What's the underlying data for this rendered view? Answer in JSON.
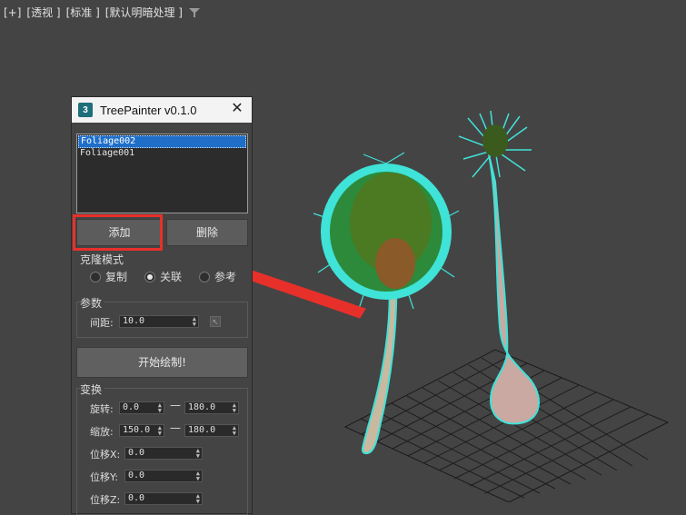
{
  "viewport": {
    "label_plus": "[+]",
    "label_view": "[透视 ]",
    "label_shading": "[标准 ]",
    "label_lighting": "[默认明暗处理 ]"
  },
  "dialog": {
    "title": "TreePainter v0.1.0",
    "app_icon_text": "3",
    "close_symbol": "✕",
    "list_items": [
      "Foliage002",
      "Foliage001"
    ],
    "selected_index": 0,
    "add_label": "添加",
    "delete_label": "删除",
    "clone_mode_label": "克隆模式",
    "clone_options": [
      "复制",
      "关联",
      "参考"
    ],
    "clone_selected": "关联",
    "params_label": "参数",
    "spacing_label": "间距:",
    "spacing_value": "10.0",
    "start_label": "开始绘制!",
    "transform_label": "变换",
    "rotate_label": "旋转:",
    "rotate_min": "0.0",
    "rotate_max": "180.0",
    "scale_label": "缩放:",
    "scale_min": "150.0",
    "scale_max": "180.0",
    "offset_x_label": "位移X:",
    "offset_x_value": "0.0",
    "offset_y_label": "位移Y:",
    "offset_y_value": "0.0",
    "offset_z_label": "位移Z:",
    "offset_z_value": "0.0",
    "dash": "—"
  },
  "colors": {
    "viewport_bg": "#444444",
    "highlight_red": "#e8302a",
    "selection_blue": "#1f6fc9",
    "foliage_cyan": "#3fe3d8"
  }
}
